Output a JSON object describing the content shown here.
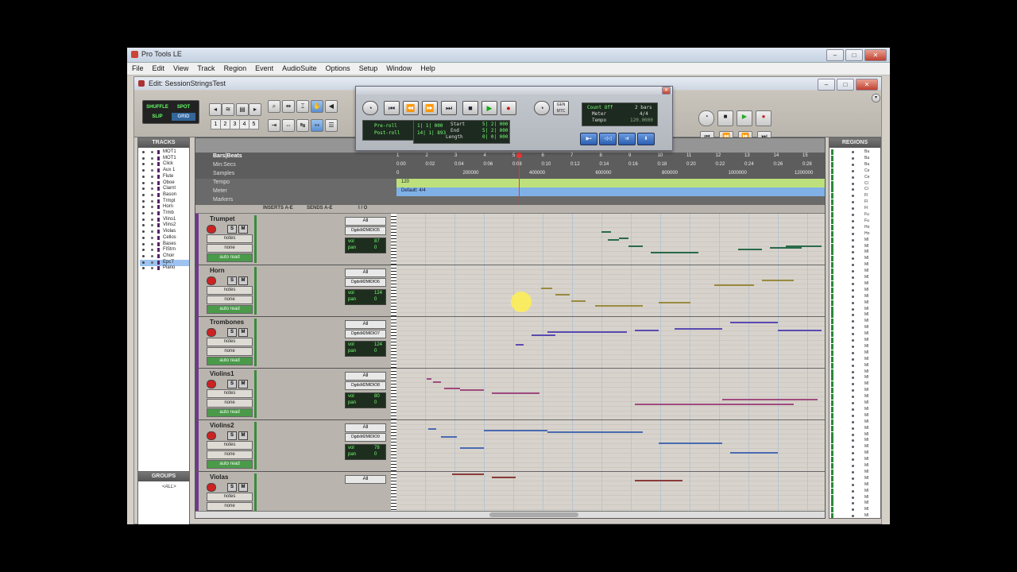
{
  "app": {
    "title": "Pro Tools LE",
    "menus": [
      "File",
      "Edit",
      "View",
      "Track",
      "Region",
      "Event",
      "AudioSuite",
      "Options",
      "Setup",
      "Window",
      "Help"
    ],
    "edit_title": "Edit: SessionStringsTest"
  },
  "toolbar": {
    "modes": [
      "SHUFFLE",
      "SPOT",
      "SLIP",
      "GRID"
    ],
    "zoom_presets": [
      "1",
      "2",
      "3",
      "4",
      "5"
    ]
  },
  "transport": {
    "preroll_label": "Pre-roll",
    "postroll_label": "Post-roll",
    "preroll": "1| 1| 000",
    "postroll": "14| 1| 893",
    "start_label": "Start",
    "end_label": "End",
    "length_label": "Length",
    "start": "5| 2| 000",
    "end": "5| 2| 000",
    "length": "0| 0| 000",
    "gen_mtc": "GEN MTC",
    "count_off": "Count Off",
    "count_off_value": "2 bars",
    "meter_label": "Meter",
    "meter_value": "4/4",
    "tempo_label": "Tempo",
    "tempo_value": "120.0000"
  },
  "tracklist": {
    "header": "TRACKS",
    "items": [
      "MOT1",
      "MOT1",
      "Click",
      "Aux 1",
      "Flute",
      "Oboe",
      "Clarnt",
      "Bason",
      "Trmpt",
      "Horn",
      "Trmb",
      "Vlins1",
      "Vlins2",
      "Violas",
      "Cellos",
      "Bases",
      "FlStrn",
      "Choir",
      "EpcT",
      "Piano"
    ]
  },
  "groups": {
    "header": "GROUPS",
    "all": "<ALL>"
  },
  "rulers": {
    "bars_label": "Bars|Beats",
    "minsecs_label": "Min:Secs",
    "samples_label": "Samples",
    "tempo_label": "Tempo",
    "meter_label": "Meter",
    "markers_label": "Markers",
    "bars": [
      "1",
      "2",
      "3",
      "4",
      "5",
      "6",
      "7",
      "8",
      "9",
      "10",
      "11",
      "12",
      "13",
      "14",
      "15"
    ],
    "minsecs": [
      "0:00",
      "0:02",
      "0:04",
      "0:06",
      "0:08",
      "0:10",
      "0:12",
      "0:14",
      "0:16",
      "0:18",
      "0:20",
      "0:22",
      "0:24",
      "0:26",
      "0:28"
    ],
    "samples": [
      "0",
      "200000",
      "400000",
      "600000",
      "800000",
      "1000000",
      "1200000"
    ],
    "tempo_value": "120",
    "meter_value": "Default: 4/4"
  },
  "columns": {
    "inserts": "INSERTS A-E",
    "sends": "SENDS A-E",
    "io": "I / O"
  },
  "tracks": [
    {
      "name": "Trumpet",
      "io_in": "All",
      "io_out": "DgdsM2MIDIO5",
      "vol": "87",
      "pan": "0"
    },
    {
      "name": "Horn",
      "io_in": "All",
      "io_out": "DgdsM2MIDIO6",
      "vol": "124",
      "pan": "0"
    },
    {
      "name": "Trombones",
      "io_in": "All",
      "io_out": "DgdsM2MIDIO7",
      "vol": "124",
      "pan": "0"
    },
    {
      "name": "Violins1",
      "io_in": "All",
      "io_out": "DgdsM2MIDIO8",
      "vol": "80",
      "pan": "0"
    },
    {
      "name": "Violins2",
      "io_in": "All",
      "io_out": "DgdsM2MIDIO9",
      "vol": "78",
      "pan": "0"
    },
    {
      "name": "Violas",
      "io_in": "All",
      "io_out": "",
      "vol": "",
      "pan": ""
    }
  ],
  "track_controls": {
    "notes": "notes",
    "none": "none",
    "auto": "auto read",
    "vol": "vol",
    "pan": "pan",
    "solo": "S",
    "mute": "M"
  },
  "regions": {
    "header": "REGIONS",
    "items": [
      "Ba",
      "Ba",
      "Ba",
      "Ce",
      "Ce",
      "Cl",
      "Cl",
      "Fl",
      "Fl",
      "Fl",
      "Fu",
      "Fu",
      "Ho",
      "Ho",
      "MI",
      "MI",
      "MI",
      "MI",
      "MI",
      "MI",
      "MI",
      "MI",
      "MI",
      "MI",
      "MI",
      "MI",
      "MI",
      "MI",
      "MI",
      "MI",
      "MI",
      "MI",
      "MI",
      "MI",
      "MI",
      "MI",
      "MI",
      "MI",
      "MI",
      "MI",
      "MI",
      "MI",
      "MI",
      "MI",
      "MI",
      "MI",
      "MI",
      "MI",
      "MI",
      "MI",
      "MI",
      "MI",
      "MI",
      "MI",
      "MI",
      "MI",
      "MI",
      "MI",
      "MI"
    ]
  },
  "colors": {
    "trumpet": "#2a6a4a",
    "horn": "#9a8a40",
    "trombones": "#5a4ab0",
    "violins1": "#a04a80",
    "violins2": "#4a6ab0",
    "violas": "#8a3a3a",
    "playhead": "#e33333",
    "tempo_ruler": "#bde07d",
    "meter_ruler": "#7fb1e6"
  }
}
